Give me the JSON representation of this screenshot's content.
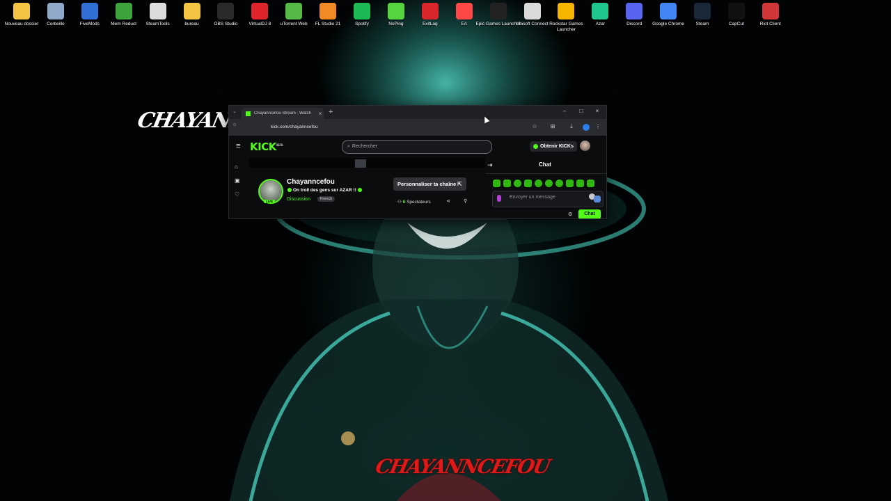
{
  "desktop_icons": [
    {
      "label": "Nouveau dossier",
      "icon": "folder-icon",
      "color": "#f4c542"
    },
    {
      "label": "Corbeille",
      "icon": "recycle-bin-icon",
      "color": "#8fa9c9"
    },
    {
      "label": "FiveMods",
      "icon": "fivemods-icon",
      "color": "#2f6fd6"
    },
    {
      "label": "Mem Reduct",
      "icon": "mem-reduct-icon",
      "color": "#3da33b"
    },
    {
      "label": "SteamTools",
      "icon": "steamtools-icon",
      "color": "#dcdcdc"
    },
    {
      "label": "bureau",
      "icon": "folder-icon",
      "color": "#f4c542"
    },
    {
      "label": "OBS Studio",
      "icon": "obs-icon",
      "color": "#2b2b2b"
    },
    {
      "label": "VirtualDJ 8",
      "icon": "virtualdj-icon",
      "color": "#e0242e"
    },
    {
      "label": "uTorrent Web",
      "icon": "utorrent-icon",
      "color": "#56b946"
    },
    {
      "label": "FL Studio 21",
      "icon": "fl-studio-icon",
      "color": "#f08a24"
    },
    {
      "label": "Spotify",
      "icon": "spotify-icon",
      "color": "#1db954"
    },
    {
      "label": "NoPing",
      "icon": "noping-icon",
      "color": "#56d43f"
    },
    {
      "label": "ExitLag",
      "icon": "exitlag-icon",
      "color": "#d8262c"
    },
    {
      "label": "EA",
      "icon": "ea-icon",
      "color": "#ff4747"
    },
    {
      "label": "Epic Games Launcher",
      "icon": "epic-games-icon",
      "color": "#222222"
    },
    {
      "label": "Ubisoft Connect",
      "icon": "ubisoft-icon",
      "color": "#d9d9d9"
    },
    {
      "label": "Rockstar Games Launcher",
      "icon": "rockstar-icon",
      "color": "#f5b400"
    },
    {
      "label": "Azar",
      "icon": "azar-icon",
      "color": "#20c68e"
    },
    {
      "label": "Discord",
      "icon": "discord-icon",
      "color": "#5865f2"
    },
    {
      "label": "Google Chrome",
      "icon": "chrome-icon",
      "color": "#4285f4"
    },
    {
      "label": "Steam",
      "icon": "steam-icon",
      "color": "#1b2838"
    },
    {
      "label": "CapCut",
      "icon": "capcut-icon",
      "color": "#111111"
    },
    {
      "label": "Riot Client",
      "icon": "riot-icon",
      "color": "#d13639"
    }
  ],
  "overlay": {
    "left_text": "CHAYANNCEFOU",
    "bottom_text": "CHAYANNCEFOU"
  },
  "browser": {
    "tab_title": "Chayanncefou Stream - Watch",
    "url": "kick.com/chayanncefou"
  },
  "kick": {
    "logo": "KICK",
    "logo_beta": "BETA",
    "search_placeholder": "Rechercher",
    "get_kicks": "Obtenir KICKs",
    "channel_name": "Chayanncefou",
    "stream_title": "On troll des gens sur AZAR !!",
    "category": "Discussion",
    "language": "French",
    "live": "LIVE",
    "customize_button": "Personnaliser ta chaîne",
    "viewers_count": "6",
    "viewers_label": "Spectateurs",
    "chat_title": "Chat",
    "message_placeholder": "Envoyer un message",
    "chat_button": "Chat"
  },
  "colors": {
    "kick_green": "#53fc18",
    "brand_red": "#e01818"
  }
}
